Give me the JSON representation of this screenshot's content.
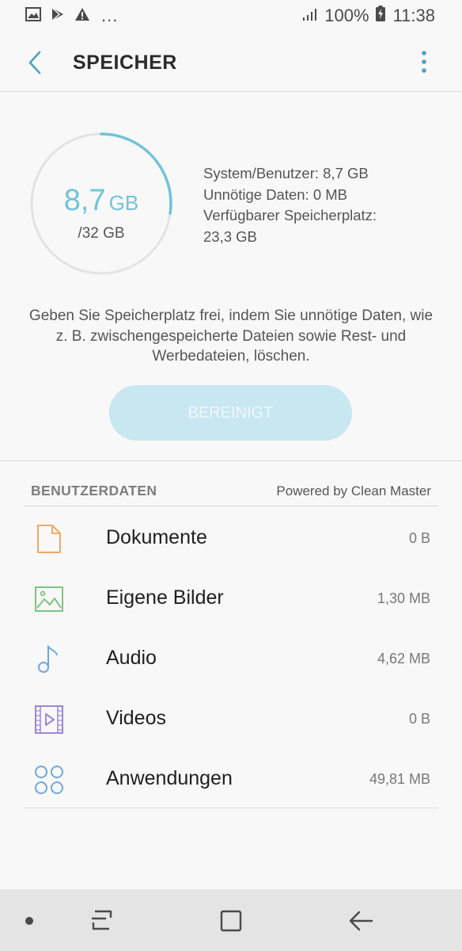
{
  "status_bar": {
    "battery": "100%",
    "time": "11:38",
    "more_indicator": "..."
  },
  "header": {
    "title": "SPEICHER"
  },
  "summary": {
    "used_value": "8,7",
    "used_unit": "GB",
    "total": "/32 GB",
    "usage_fraction": 0.272,
    "stats": {
      "system_user": "System/Benutzer: 8,7 GB",
      "junk": "Unnötige Daten: 0 MB",
      "available_label": "Verfügbarer Speicherplatz:",
      "available_value": "23,3 GB"
    },
    "description": "Geben Sie Speicherplatz frei, indem Sie unnötige Daten, wie z. B. zwischengespeicherte Dateien sowie Rest- und Werbedateien, löschen.",
    "clean_button": "BEREINIGT"
  },
  "user_data": {
    "title": "BENUTZERDATEN",
    "powered_by": "Powered by Clean Master",
    "items": [
      {
        "label": "Dokumente",
        "size": "0 B",
        "icon": "document-icon"
      },
      {
        "label": "Eigene Bilder",
        "size": "1,30 MB",
        "icon": "image-icon"
      },
      {
        "label": "Audio",
        "size": "4,62 MB",
        "icon": "music-note-icon"
      },
      {
        "label": "Videos",
        "size": "0 B",
        "icon": "video-icon"
      },
      {
        "label": "Anwendungen",
        "size": "49,81 MB",
        "icon": "apps-grid-icon"
      }
    ]
  },
  "colors": {
    "accent": "#72c3d9",
    "button_bg": "#c8e7f1",
    "document": "#f0a862",
    "image": "#7cc47f",
    "audio": "#6fa8dc",
    "video": "#9b86d6",
    "apps": "#6fa8dc"
  }
}
